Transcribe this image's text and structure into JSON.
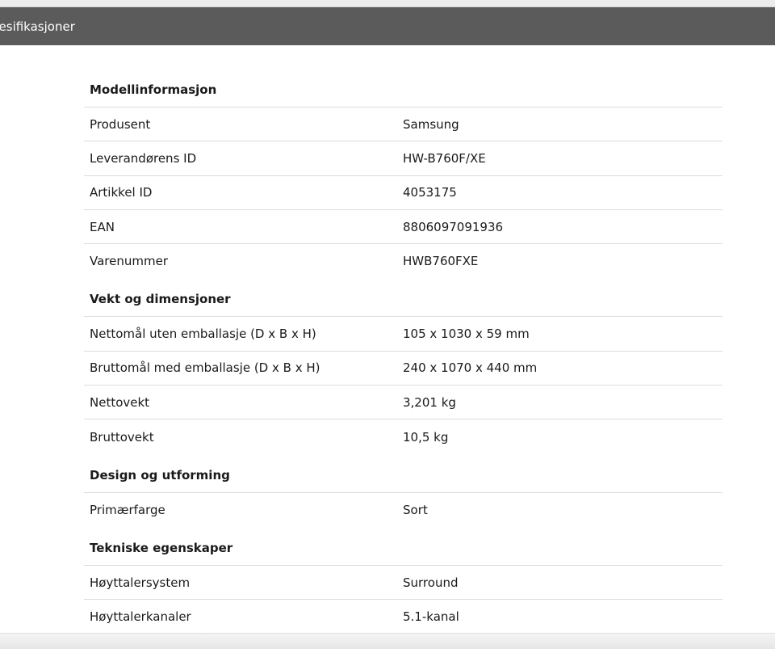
{
  "header": {
    "title": "pesifikasjoner"
  },
  "sections": [
    {
      "title": "Modellinformasjon",
      "rows": [
        {
          "label": "Produsent",
          "value": "Samsung"
        },
        {
          "label": "Leverandørens ID",
          "value": "HW-B760F/XE"
        },
        {
          "label": "Artikkel ID",
          "value": "4053175"
        },
        {
          "label": "EAN",
          "value": "8806097091936"
        },
        {
          "label": "Varenummer",
          "value": "HWB760FXE"
        }
      ]
    },
    {
      "title": "Vekt og dimensjoner",
      "rows": [
        {
          "label": "Nettomål uten emballasje (D x B x H)",
          "value": "105 x 1030 x 59 mm"
        },
        {
          "label": "Bruttomål med emballasje (D x B x H)",
          "value": "240 x 1070 x 440 mm"
        },
        {
          "label": "Nettovekt",
          "value": "3,201 kg"
        },
        {
          "label": "Bruttovekt",
          "value": "10,5 kg"
        }
      ]
    },
    {
      "title": "Design og utforming",
      "rows": [
        {
          "label": "Primærfarge",
          "value": "Sort"
        }
      ]
    },
    {
      "title": "Tekniske egenskaper",
      "rows": [
        {
          "label": "Høyttalersystem",
          "value": "Surround"
        },
        {
          "label": "Høyttalerkanaler",
          "value": "5.1-kanal"
        }
      ]
    }
  ]
}
